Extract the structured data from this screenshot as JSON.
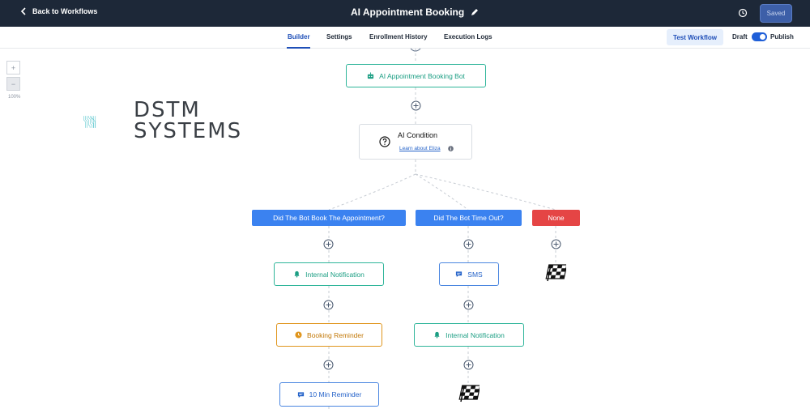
{
  "header": {
    "back_label": "Back to Workflows",
    "title": "AI Appointment Booking",
    "saved_label": "Saved"
  },
  "tabs": [
    {
      "label": "Builder",
      "active": true
    },
    {
      "label": "Settings",
      "active": false
    },
    {
      "label": "Enrollment History",
      "active": false
    },
    {
      "label": "Execution Logs",
      "active": false
    }
  ],
  "actions": {
    "test_label": "Test Workflow",
    "draft_label": "Draft",
    "publish_label": "Publish",
    "published": true
  },
  "zoom": {
    "plus": "+",
    "minus": "−",
    "level": "100%"
  },
  "logo": {
    "line1": "DSTM",
    "line2": "SYSTEMS"
  },
  "nodes": {
    "bot": "AI Appointment Booking Bot",
    "condition_title": "AI Condition",
    "condition_link": "Learn about Eliza",
    "branch1": "Did The Bot Book The Appointment?",
    "branch2": "Did The Bot Time Out?",
    "branch3": "None",
    "b1_action1": "Internal Notification",
    "b1_action2": "Booking Reminder",
    "b1_action3": "10 Min Reminder",
    "b2_action1": "SMS",
    "b2_action2": "Internal Notification"
  },
  "colors": {
    "header_bg": "#1d2838",
    "accent": "#1f4fb8",
    "branch_blue": "#3b82f0",
    "branch_red": "#e54545",
    "node_green": "#2fb59a",
    "node_orange": "#e0951c"
  }
}
